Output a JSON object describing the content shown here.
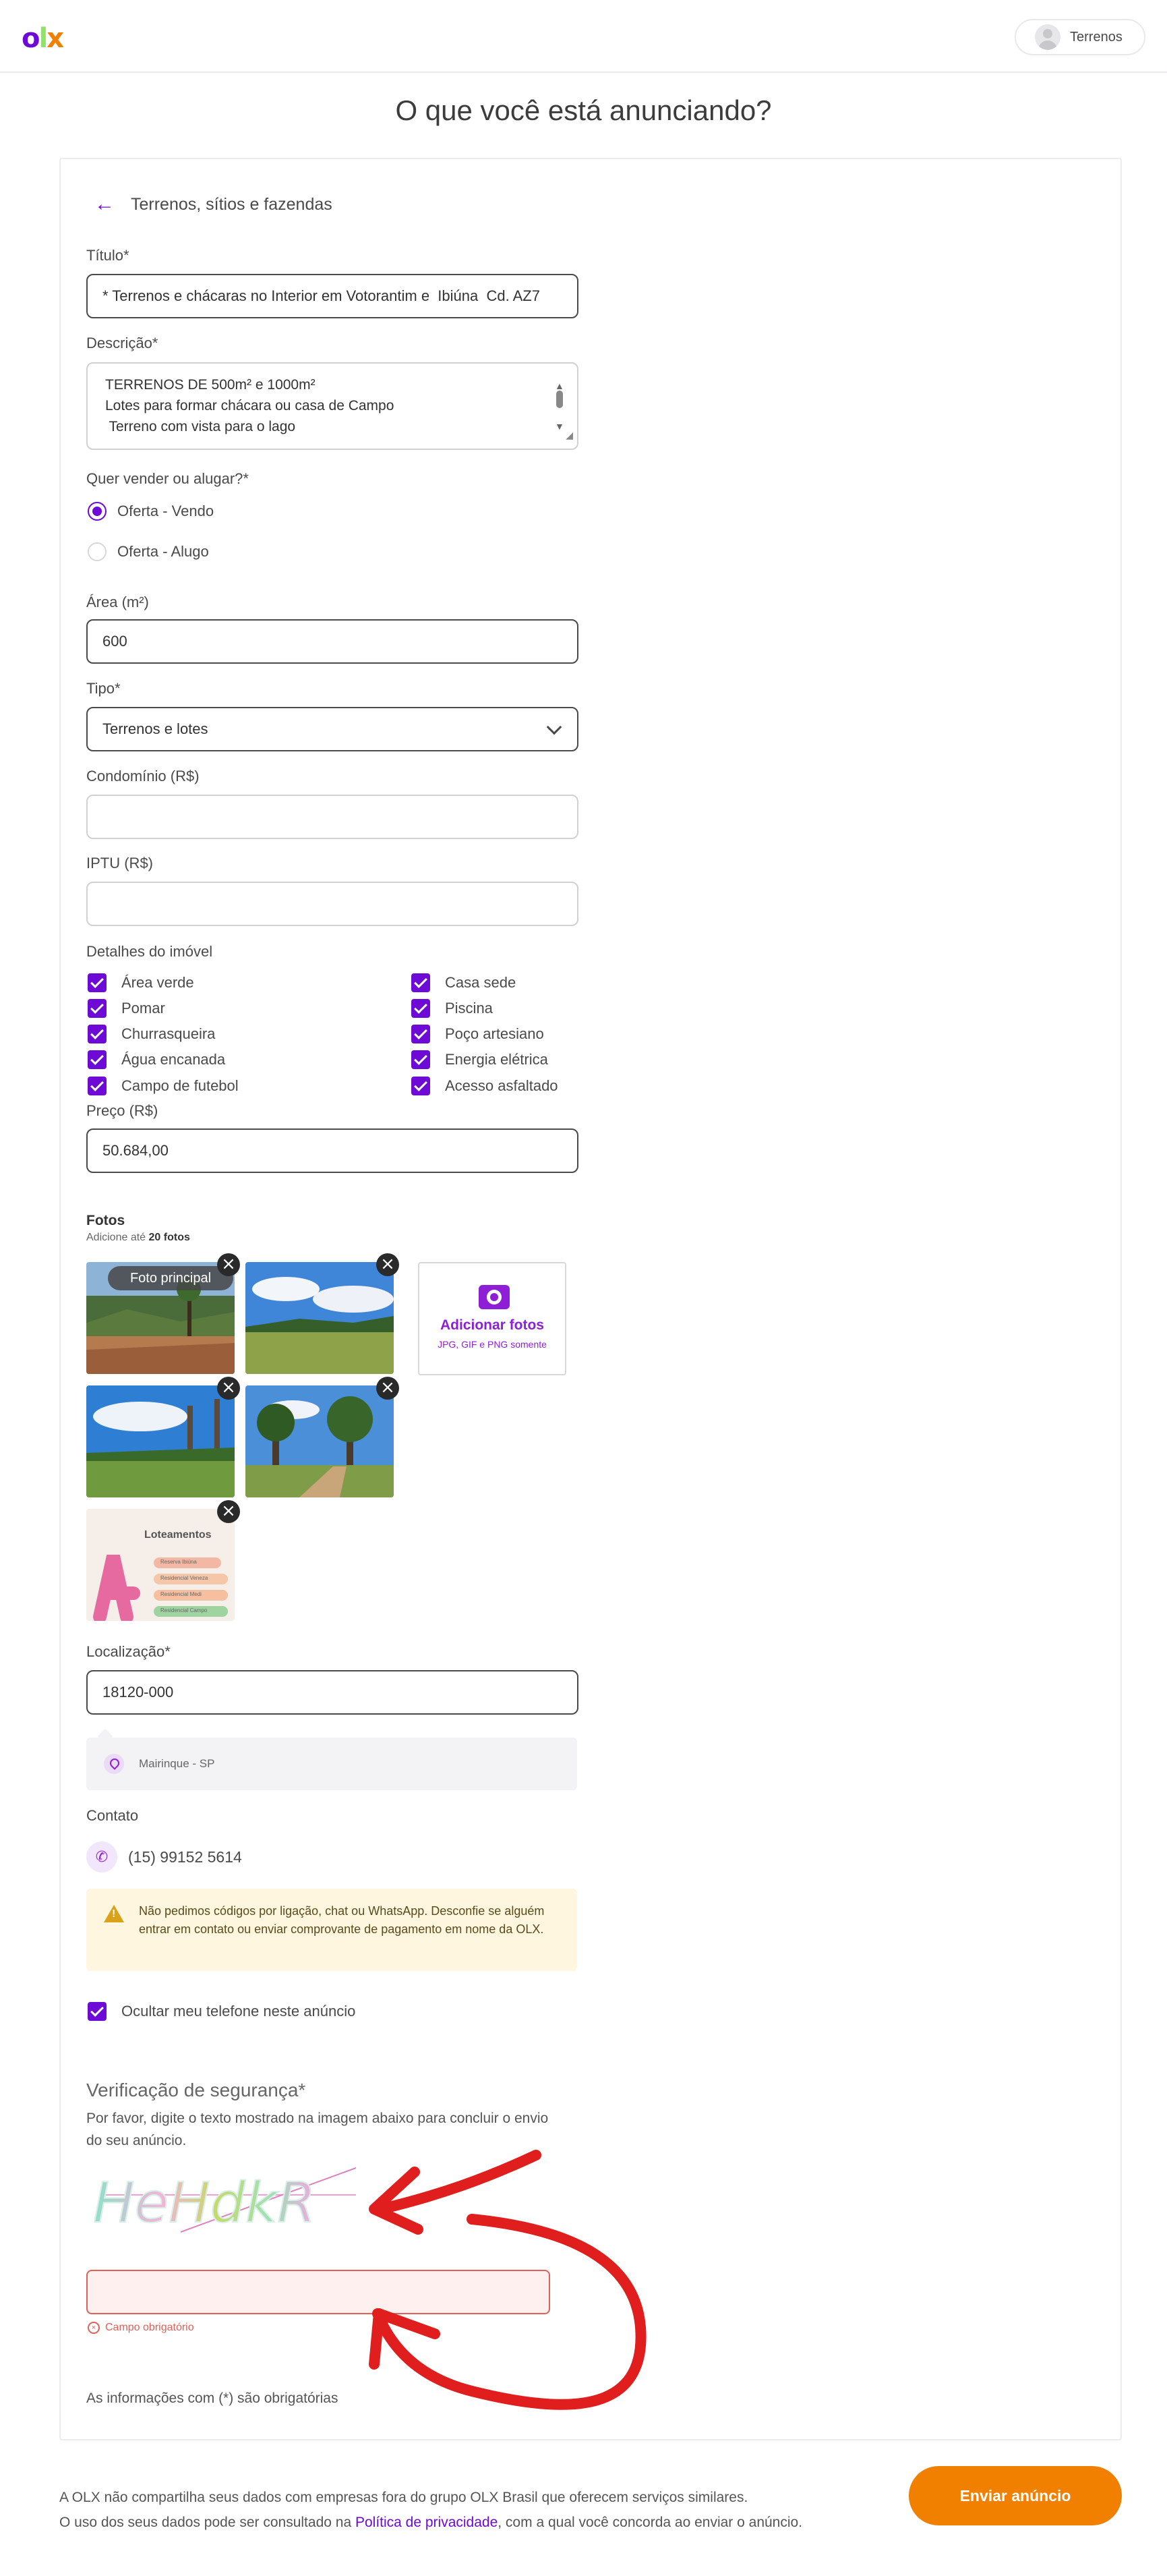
{
  "header": {
    "logo": [
      "o",
      "l",
      "x"
    ],
    "user_label": "Terrenos"
  },
  "page_title": "O que você está anunciando?",
  "category": {
    "label": "Terrenos, sítios e fazendas"
  },
  "form": {
    "title": {
      "label": "Título*",
      "value": "* Terrenos e chácaras no Interior em Votorantim e  Ibiúna  Cd. AZ7"
    },
    "description": {
      "label": "Descrição*",
      "lines": [
        "TERRENOS DE 500m² e 1000m²",
        "Lotes para formar chácara ou casa de Campo",
        " Terreno com vista para o lago"
      ]
    },
    "operation": {
      "label": "Quer vender ou alugar?*",
      "options": [
        "Oferta - Vendo",
        "Oferta - Alugo"
      ],
      "selected": "Oferta - Vendo"
    },
    "area": {
      "label": "Área (m²)",
      "value": "600"
    },
    "type": {
      "label": "Tipo*",
      "value": "Terrenos e lotes"
    },
    "condo": {
      "label": "Condomínio (R$)",
      "value": ""
    },
    "iptu": {
      "label": "IPTU (R$)",
      "value": ""
    },
    "details": {
      "label": "Detalhes do imóvel",
      "left": [
        "Área verde",
        "Pomar",
        "Churrasqueira",
        "Água encanada",
        "Campo de futebol"
      ],
      "right": [
        "Casa sede",
        "Piscina",
        "Poço artesiano",
        "Energia elétrica",
        "Acesso asfaltado"
      ]
    },
    "price": {
      "label": "Preço (R$)",
      "value": "50.684,00"
    },
    "photos": {
      "label": "Fotos",
      "hint_prefix": "Adicione até ",
      "hint_bold": "20 fotos",
      "main_badge": "Foto principal",
      "add_title": "Adicionar fotos",
      "add_sub": "JPG, GIF e PNG somente",
      "poster_title": "Loteamentos",
      "poster_items": [
        "Reserva Ibiúna",
        "Residencial Veneza",
        "Residencial Medi",
        "Residencial Campo"
      ]
    },
    "location": {
      "label": "Localização*",
      "value": "18120-000",
      "city": "Mairinque - SP"
    },
    "contact": {
      "label": "Contato",
      "phone": "(15) 99152 5614",
      "warning": "Não pedimos códigos por ligação, chat ou WhatsApp. Desconfie se alguém entrar em contato ou enviar comprovante de pagamento em nome da OLX.",
      "hide_phone": "Ocultar meu telefone neste anúncio"
    },
    "security": {
      "title": "Verificação de segurança*",
      "desc": "Por favor, digite o texto mostrado na imagem abaixo para concluir o envio do seu anúncio.",
      "captcha_text": "HeHdkR",
      "error": "Campo obrigatório"
    },
    "required_note": "As informações com (*) são obrigatórias"
  },
  "footer": {
    "line1": "A OLX não compartilha seus dados com empresas fora do grupo OLX Brasil que oferecem serviços similares.",
    "line2_pre": "O uso dos seus dados pode ser consultado na ",
    "line2_link": "Política de privacidade",
    "line2_post": ", com a qual você concorda ao enviar o anúncio.",
    "submit": "Enviar anúncio"
  },
  "colors": {
    "brand_purple": "#6e0ad6",
    "brand_orange": "#f28000",
    "annotation_red": "#e01e1e"
  }
}
